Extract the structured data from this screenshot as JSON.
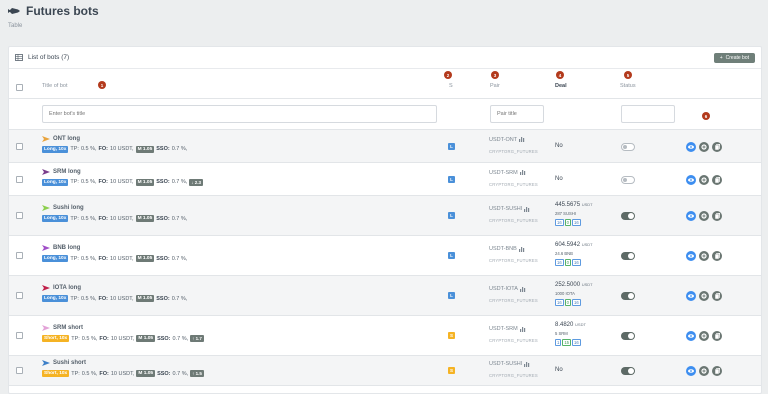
{
  "page": {
    "title": "Futures bots",
    "subtitle": "Table"
  },
  "card": {
    "title": "List of bots (7)",
    "create_label": "Create bot"
  },
  "columns": {
    "title": "Title of bot",
    "s": "S",
    "pair": "Pair",
    "deal": "Deal",
    "status": "Status"
  },
  "badges": [
    "1",
    "2",
    "3",
    "4",
    "5",
    "6"
  ],
  "filters": {
    "title_placeholder": "Enter bot's title",
    "pair_placeholder": "Pair title"
  },
  "colors": {
    "long": "#4a90d9",
    "short": "#f5b324",
    "action_blue": "#3d8ef0",
    "action_grey": "#6a7672",
    "badge_red": "#b33a1c"
  },
  "rows": [
    {
      "name": "ONT long",
      "flag_color": "#e8a33d",
      "side": "Long, 10x",
      "side_type": "long",
      "tp_label": "TP:",
      "tp": "0.5 %,",
      "fo_label": "FO:",
      "fo": "10 USDT,",
      "m": "M 1.05",
      "sso_label": "SSO:",
      "sso": "0.7 %,",
      "extra": "",
      "s": "L",
      "pair": "USDT-ONT",
      "exchange": "CRYPTORG_FUTURES",
      "deal": "No",
      "deal_unit": "",
      "deal_sub": "",
      "chips": [],
      "status": false
    },
    {
      "name": "SRM long",
      "flag_color": "#7a3d8c",
      "side": "Long, 10x",
      "side_type": "long",
      "tp_label": "TP:",
      "tp": "0.5 %,",
      "fo_label": "FO:",
      "fo": "10 USDT,",
      "m": "M 1.05",
      "sso_label": "SSO:",
      "sso": "0.7 %,",
      "extra": "↓ 2.3",
      "s": "L",
      "pair": "USDT-SRM",
      "exchange": "CRYPTORG_FUTURES",
      "deal": "No",
      "deal_unit": "",
      "deal_sub": "",
      "chips": [],
      "status": false
    },
    {
      "name": "Sushi long",
      "flag_color": "#8ccf4d",
      "side": "Long, 10x",
      "side_type": "long",
      "tp_label": "TP:",
      "tp": "0.5 %,",
      "fo_label": "FO:",
      "fo": "10 USDT,",
      "m": "M 1.05",
      "sso_label": "SSO:",
      "sso": "0.7 %,",
      "extra": "",
      "s": "L",
      "pair": "USDT-SUSHI",
      "exchange": "CRYPTORG_FUTURES",
      "deal": "445.5675",
      "deal_unit": "USDT",
      "deal_sub": "287 SUSHI",
      "chips": [
        "16",
        "0",
        "16"
      ],
      "status": true
    },
    {
      "name": "BNB long",
      "flag_color": "#a04fc8",
      "side": "Long, 10x",
      "side_type": "long",
      "tp_label": "TP:",
      "tp": "0.5 %,",
      "fo_label": "FO:",
      "fo": "10 USDT,",
      "m": "M 1.05",
      "sso_label": "SSO:",
      "sso": "0.7 %,",
      "extra": "",
      "s": "L",
      "pair": "USDT-BNB",
      "exchange": "CRYPTORG_FUTURES",
      "deal": "604.5942",
      "deal_unit": "USDT",
      "deal_sub": "24.6 BNB",
      "chips": [
        "16",
        "0",
        "16"
      ],
      "status": true
    },
    {
      "name": "IOTA long",
      "flag_color": "#c0204a",
      "side": "Long, 10x",
      "side_type": "long",
      "tp_label": "TP:",
      "tp": "0.5 %,",
      "fo_label": "FO:",
      "fo": "10 USDT,",
      "m": "M 1.05",
      "sso_label": "SSO:",
      "sso": "0.7 %,",
      "extra": "",
      "s": "L",
      "pair": "USDT-IOTA",
      "exchange": "CRYPTORG_FUTURES",
      "deal": "252.5000",
      "deal_unit": "USDT",
      "deal_sub": "1000 IOTA",
      "chips": [
        "16",
        "0",
        "16"
      ],
      "status": true
    },
    {
      "name": "SRM short",
      "flag_color": "#e3a3d8",
      "side": "Short, 10x",
      "side_type": "short",
      "tp_label": "TP:",
      "tp": "0.5 %,",
      "fo_label": "FO:",
      "fo": "10 USDT,",
      "m": "M 1.05",
      "sso_label": "SSO:",
      "sso": "0.7 %,",
      "extra": "↑ 1.7",
      "s": "S",
      "pair": "USDT-SRM",
      "exchange": "CRYPTORG_FUTURES",
      "deal": "8.4820",
      "deal_unit": "USDT",
      "deal_sub": "5 SRM",
      "chips": [
        "1",
        "15",
        "16"
      ],
      "status": true
    },
    {
      "name": "Sushi short",
      "flag_color": "#3d7fc8",
      "side": "Short, 10x",
      "side_type": "short",
      "tp_label": "TP:",
      "tp": "0.5 %,",
      "fo_label": "FO:",
      "fo": "10 USDT,",
      "m": "M 1.05",
      "sso_label": "SSO:",
      "sso": "0.7 %,",
      "extra": "↑ 1.5",
      "s": "S",
      "pair": "USDT-SUSHI",
      "exchange": "CRYPTORG_FUTURES",
      "deal": "No",
      "deal_unit": "",
      "deal_sub": "",
      "chips": [],
      "status": true
    }
  ]
}
